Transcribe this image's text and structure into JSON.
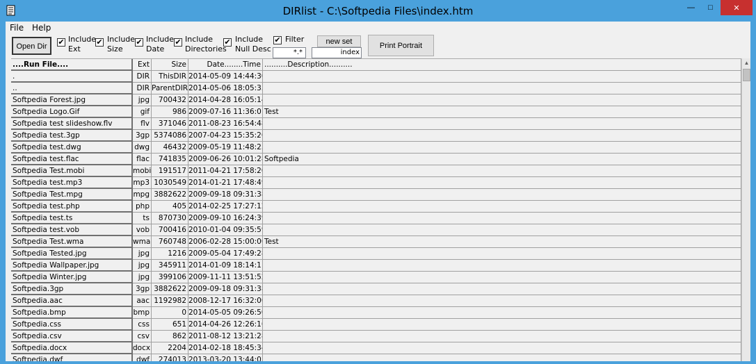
{
  "window": {
    "title": "DIRlist - C:\\Softpedia Files\\index.htm",
    "minimize": "—",
    "maximize": "□",
    "close": "✕"
  },
  "menu": {
    "file": "File",
    "help": "Help"
  },
  "toolbar": {
    "open_dir": "Open Dir",
    "options": [
      {
        "line1": "Include",
        "line2": "Ext",
        "checked": "✔"
      },
      {
        "line1": "Include",
        "line2": "Size",
        "checked": "✔"
      },
      {
        "line1": "Include",
        "line2": "Date",
        "checked": "✔"
      },
      {
        "line1": "Include",
        "line2": "Directories",
        "checked": "✔"
      },
      {
        "line1": "Include",
        "line2": "Null Desc",
        "checked": "✔"
      }
    ],
    "filter_label": "Filter",
    "filter_checked": "✔",
    "filter_value": "*.*",
    "new_set": "new set",
    "index_value": "index",
    "print_portrait": "Print Portrait"
  },
  "table": {
    "headers": {
      "name": "....Run File....",
      "ext": "Ext",
      "size": "Size",
      "date": "Date........Time",
      "desc": "..........Description.........."
    },
    "rows": [
      {
        "name": ".",
        "ext": "DIR",
        "size": "ThisDIR",
        "date": "2014-05-09 14:44:30",
        "desc": ""
      },
      {
        "name": "..",
        "ext": "DIR",
        "size": "ParentDIR",
        "date": "2014-05-06 18:05:35",
        "desc": ""
      },
      {
        "name": "Softpedia Forest.jpg",
        "ext": "jpg",
        "size": "700432",
        "date": "2014-04-28 16:05:14",
        "desc": ""
      },
      {
        "name": "Softpedia Logo.Gif",
        "ext": "gif",
        "size": "986",
        "date": "2009-07-16 11:36:01",
        "desc": "Test"
      },
      {
        "name": "Softpedia test slideshow.flv",
        "ext": "flv",
        "size": "371046",
        "date": "2011-08-23 16:54:48",
        "desc": ""
      },
      {
        "name": "Softpedia test.3gp",
        "ext": "3gp",
        "size": "5374086",
        "date": "2007-04-23 15:35:26",
        "desc": ""
      },
      {
        "name": "Softpedia test.dwg",
        "ext": "dwg",
        "size": "46432",
        "date": "2009-05-19 11:48:25",
        "desc": ""
      },
      {
        "name": "Softpedia test.flac",
        "ext": "flac",
        "size": "741835",
        "date": "2009-06-26 10:01:28",
        "desc": "Softpedia"
      },
      {
        "name": "Softpedia Test.mobi",
        "ext": "mobi",
        "size": "191517",
        "date": "2011-04-21 17:58:20",
        "desc": ""
      },
      {
        "name": "Softpedia test.mp3",
        "ext": "mp3",
        "size": "1030549",
        "date": "2014-01-21 17:48:49",
        "desc": ""
      },
      {
        "name": "Softpedia Test.mpg",
        "ext": "mpg",
        "size": "3882622",
        "date": "2009-09-18 09:31:38",
        "desc": ""
      },
      {
        "name": "Softpedia test.php",
        "ext": "php",
        "size": "405",
        "date": "2014-02-25 17:27:12",
        "desc": ""
      },
      {
        "name": "Softpedia test.ts",
        "ext": "ts",
        "size": "870730",
        "date": "2009-09-10 16:24:39",
        "desc": ""
      },
      {
        "name": "Softpedia test.vob",
        "ext": "vob",
        "size": "700416",
        "date": "2010-01-04 09:35:59",
        "desc": ""
      },
      {
        "name": "Softpedia Test.wma",
        "ext": "wma",
        "size": "760748",
        "date": "2006-02-28 15:00:00",
        "desc": "Test"
      },
      {
        "name": "Softpedia Tested.jpg",
        "ext": "jpg",
        "size": "1216",
        "date": "2009-05-04 17:49:28",
        "desc": ""
      },
      {
        "name": "Softpedia Wallpaper.jpg",
        "ext": "jpg",
        "size": "345911",
        "date": "2014-01-09 18:14:11",
        "desc": ""
      },
      {
        "name": "Softpedia Winter.jpg",
        "ext": "jpg",
        "size": "399106",
        "date": "2009-11-11 13:51:52",
        "desc": ""
      },
      {
        "name": "Softpedia.3gp",
        "ext": "3gp",
        "size": "3882622",
        "date": "2009-09-18 09:31:38",
        "desc": ""
      },
      {
        "name": "Softpedia.aac",
        "ext": "aac",
        "size": "1192982",
        "date": "2008-12-17 16:32:00",
        "desc": ""
      },
      {
        "name": "Softpedia.bmp",
        "ext": "bmp",
        "size": "0",
        "date": "2014-05-05 09:26:50",
        "desc": ""
      },
      {
        "name": "Softpedia.css",
        "ext": "css",
        "size": "651",
        "date": "2014-04-26 12:26:16",
        "desc": ""
      },
      {
        "name": "Softpedia.csv",
        "ext": "csv",
        "size": "862",
        "date": "2011-08-12 13:21:28",
        "desc": ""
      },
      {
        "name": "Softpedia.docx",
        "ext": "docx",
        "size": "2204",
        "date": "2014-02-18 18:45:34",
        "desc": ""
      },
      {
        "name": "Softpedia.dwf",
        "ext": "dwf",
        "size": "274013",
        "date": "2013-03-20 13:44:03",
        "desc": ""
      }
    ]
  },
  "colors": {
    "titlebar": "#4aa1dc",
    "close": "#c7302f",
    "face": "#f0f0f0"
  },
  "icons": {
    "app": "app-list-icon",
    "up": "scroll-up-arrow-icon"
  }
}
